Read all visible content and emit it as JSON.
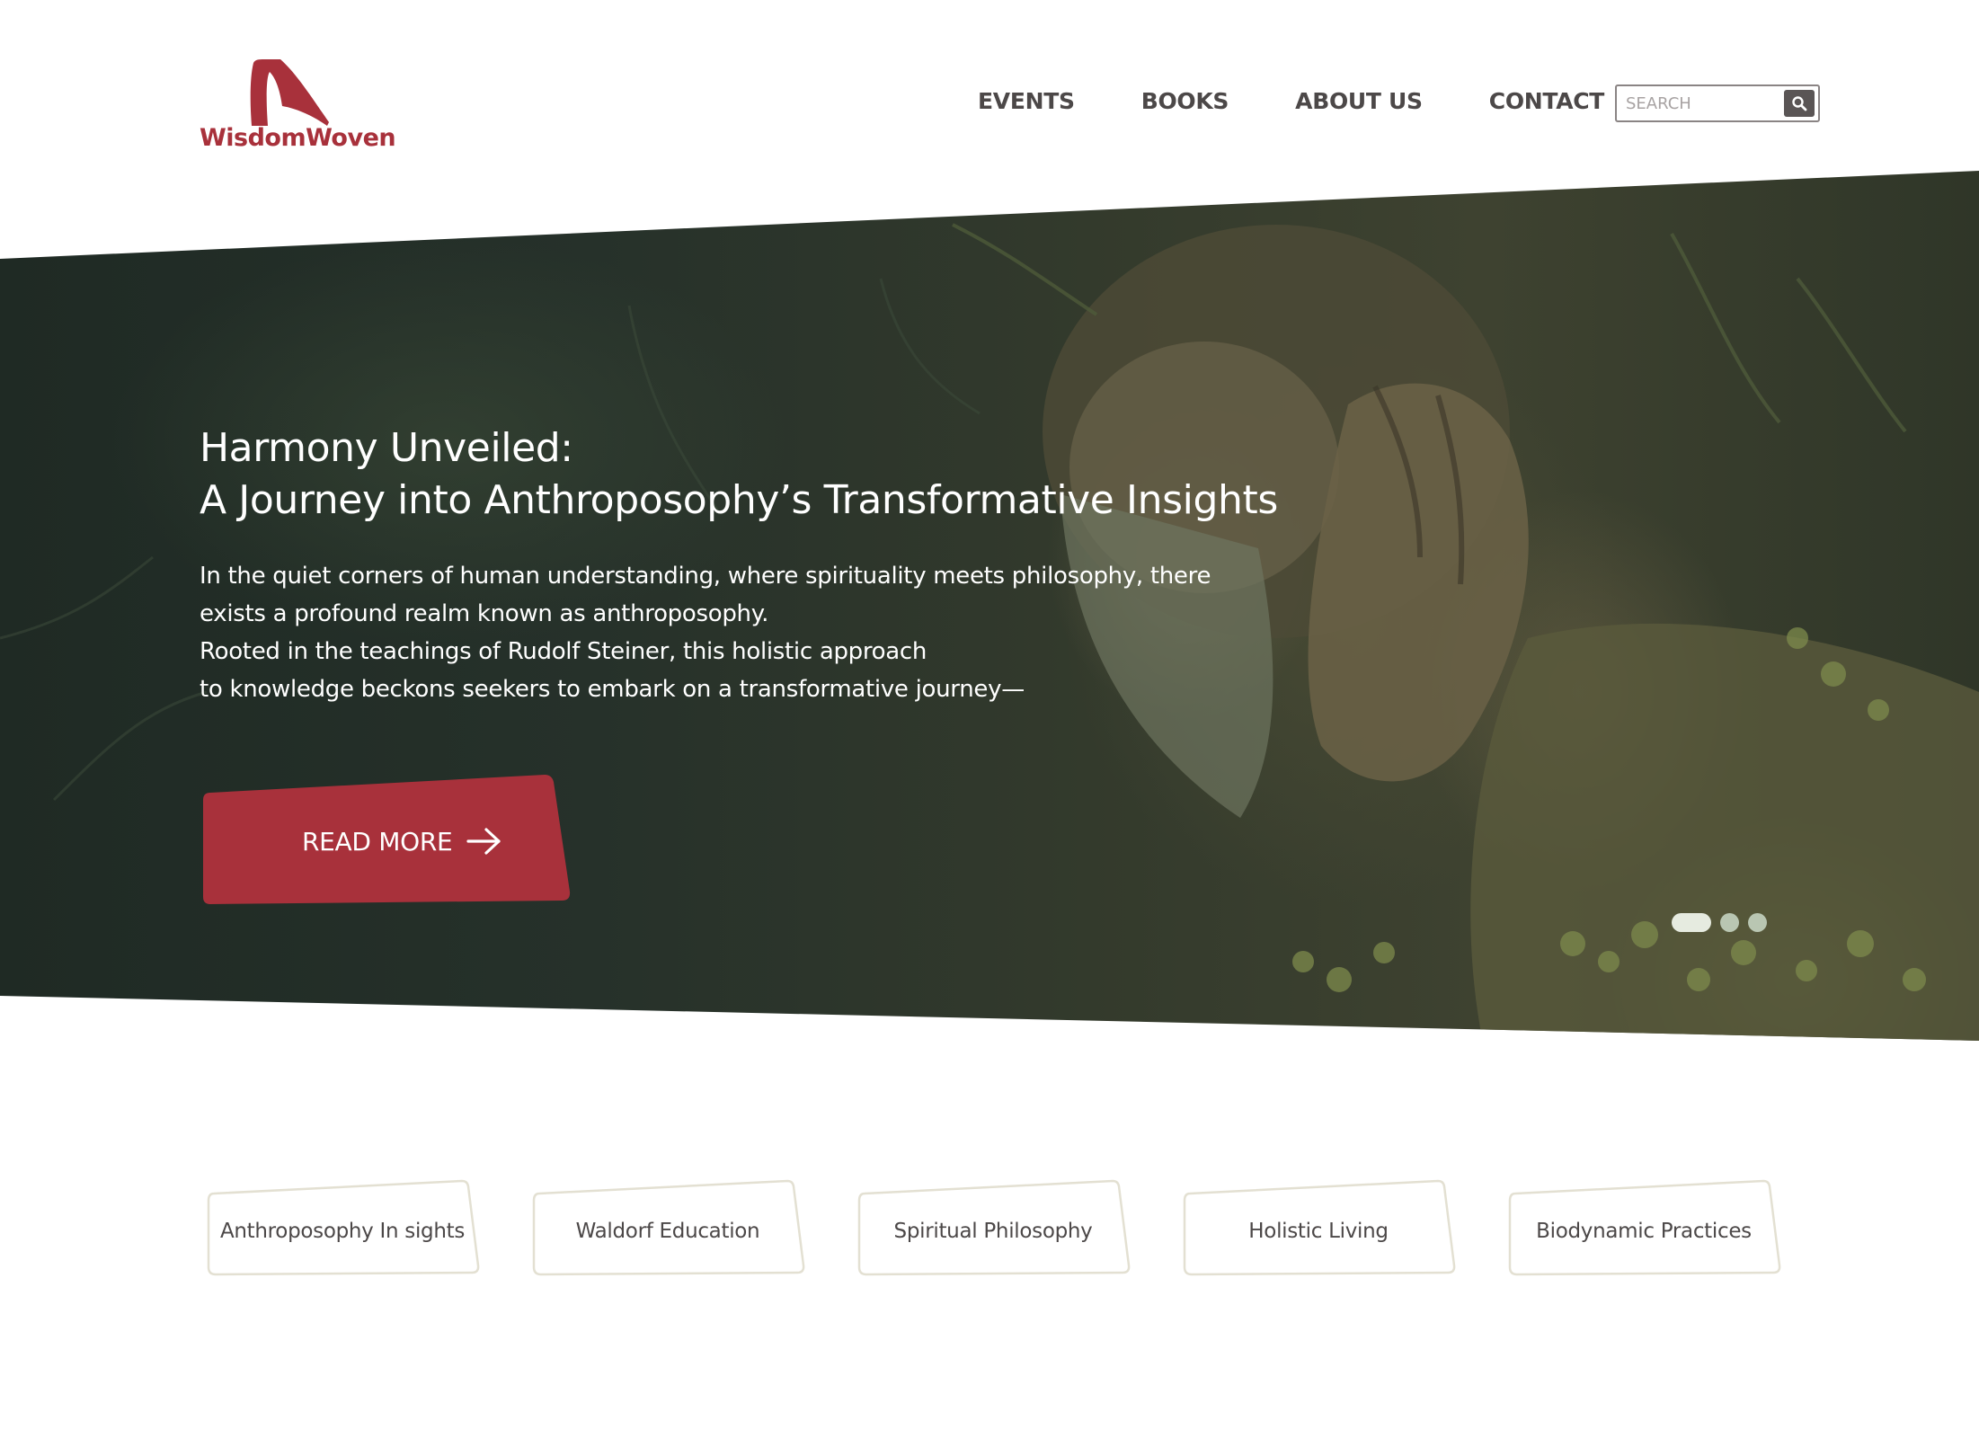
{
  "brand": {
    "name": "WisdomWoven",
    "color": "#a8313b"
  },
  "nav": {
    "items": [
      {
        "label": "EVENTS"
      },
      {
        "label": "BOOKS"
      },
      {
        "label": "ABOUT US"
      },
      {
        "label": "CONTACT"
      }
    ]
  },
  "search": {
    "placeholder": "SEARCH",
    "value": "",
    "icon": "search-icon"
  },
  "hero": {
    "title_line1": "Harmony Unveiled:",
    "title_line2": "A Journey into Anthroposophy’s Transformative Insights",
    "body_lines": [
      "In the quiet corners of human understanding, where spirituality meets philosophy, there",
      "exists a profound realm known as anthroposophy.",
      "Rooted in the teachings of Rudolf Steiner, this holistic approach",
      "to knowledge beckons seekers to embark on a transformative journey—"
    ],
    "cta_label": "READ MORE",
    "cta_icon": "arrow-right-icon",
    "cta_color": "#a8313b",
    "slides_total": 3,
    "slide_active": 1
  },
  "categories": [
    {
      "label": "Anthroposophy In sights"
    },
    {
      "label": "Waldorf Education"
    },
    {
      "label": "Spiritual Philosophy"
    },
    {
      "label": "Holistic Living"
    },
    {
      "label": "Biodynamic Practices"
    }
  ],
  "colors": {
    "text_dark": "#4c4848",
    "tag_border": "#e3e0d2",
    "dot_active": "#e6ebe0",
    "dot_inactive": "#b9c6b2"
  }
}
